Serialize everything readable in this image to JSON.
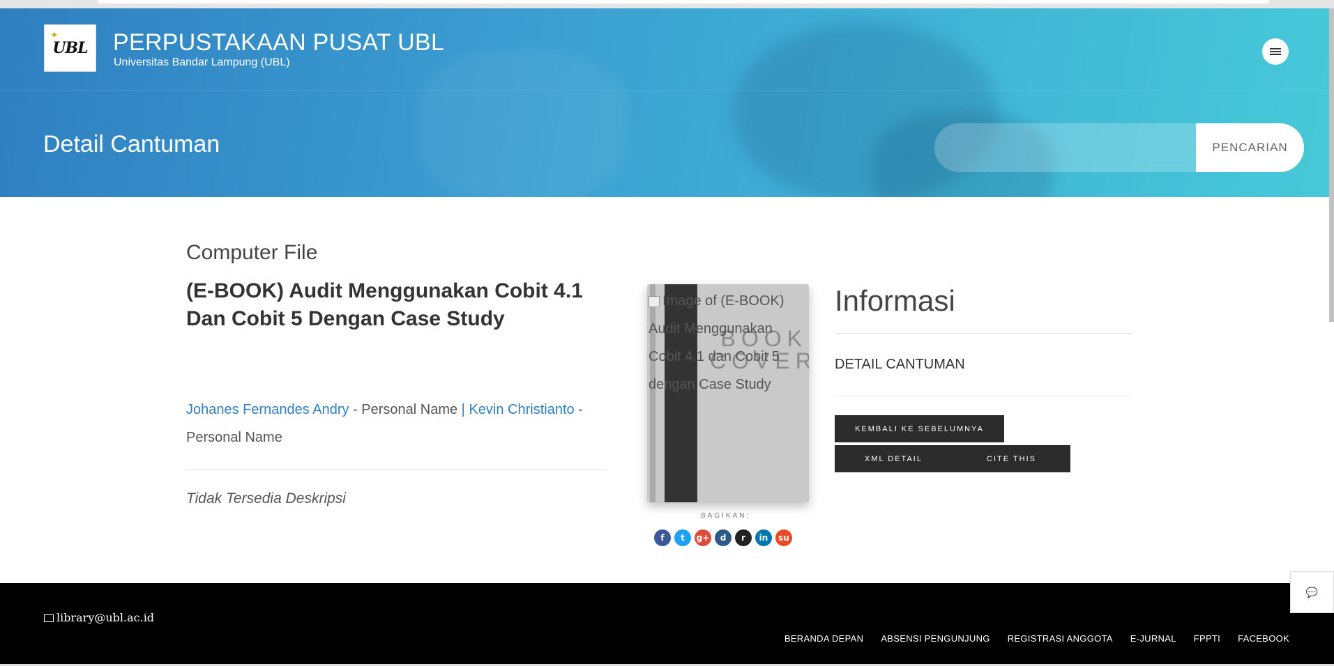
{
  "header": {
    "logo_text": "UBL",
    "site_title": "PERPUSTAKAAN PUSAT UBL",
    "site_subtitle": "Universitas Bandar Lampung (UBL)",
    "page_heading": "Detail Cantuman",
    "search_placeholder": "",
    "search_button": "PENCARIAN"
  },
  "record": {
    "gmd": "Computer File",
    "title": "(E-BOOK) Audit Menggunakan Cobit 4.1 Dan Cobit 5 Dengan Case Study",
    "authors": [
      {
        "name": "Johanes Fernandes Andry",
        "role": " - Personal Name "
      },
      {
        "name": "Kevin Christianto",
        "role": " - Personal Name"
      }
    ],
    "author_separator": "| ",
    "description": "Tidak Tersedia Deskripsi",
    "cover_alt": "Image of (E-BOOK) Audit Menggunakan Cobit 4.1 dan Cobit 5 dengan Case Study",
    "cover_label": "BOOK COVER"
  },
  "share": {
    "label": "BAGIKAN:",
    "icons": [
      {
        "name": "facebook-icon",
        "glyph": "f",
        "color": "#3b5998"
      },
      {
        "name": "twitter-icon",
        "glyph": "t",
        "color": "#1da1f2"
      },
      {
        "name": "google-plus-icon",
        "glyph": "g+",
        "color": "#dd4b39"
      },
      {
        "name": "digg-icon",
        "glyph": "d",
        "color": "#2d5a8a"
      },
      {
        "name": "reddit-icon",
        "glyph": "r",
        "color": "#222222"
      },
      {
        "name": "linkedin-icon",
        "glyph": "in",
        "color": "#0077b5"
      },
      {
        "name": "stumbleupon-icon",
        "glyph": "su",
        "color": "#eb4924"
      }
    ]
  },
  "info": {
    "title": "Informasi",
    "detail_label": "DETAIL CANTUMAN",
    "back_button": "KEMBALI KE SEBELUMNYA",
    "xml_button": "XML DETAIL",
    "cite_button": "CITE THIS"
  },
  "footer": {
    "email": "library@ubl.ac.id",
    "nav": [
      "BERANDA DEPAN",
      "ABSENSI PENGUNJUNG",
      "REGISTRASI ANGGOTA",
      "E-JURNAL",
      "FPPTI",
      "FACEBOOK"
    ]
  }
}
